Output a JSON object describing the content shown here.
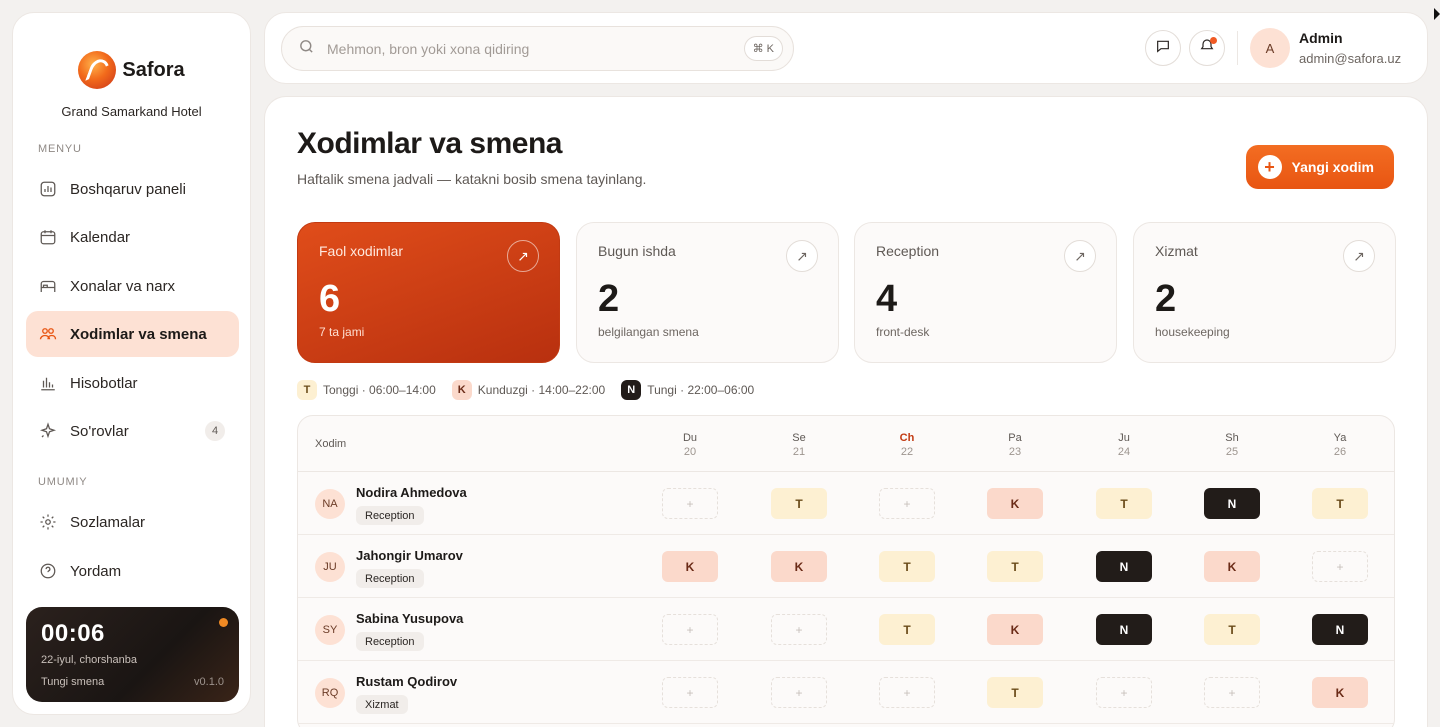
{
  "brand": {
    "name": "Safora",
    "hotel": "Grand Samarkand Hotel"
  },
  "sidebar": {
    "menu_label": "MENYU",
    "menu": [
      {
        "label": "Boshqaruv paneli",
        "icon": "dashboard-icon"
      },
      {
        "label": "Kalendar",
        "icon": "calendar-icon"
      },
      {
        "label": "Xonalar va narx",
        "icon": "bed-icon"
      },
      {
        "label": "Xodimlar va smena",
        "icon": "users-icon",
        "active": true
      },
      {
        "label": "Hisobotlar",
        "icon": "bar-chart-icon"
      },
      {
        "label": "So'rovlar",
        "icon": "sparkle-icon",
        "badge": "4"
      }
    ],
    "general_label": "UMUMIY",
    "general": [
      {
        "label": "Sozlamalar",
        "icon": "gear-icon"
      },
      {
        "label": "Yordam",
        "icon": "help-icon"
      }
    ],
    "clock": {
      "time": "00:06",
      "date": "22-iyul, chorshanba",
      "shift": "Tungi smena",
      "version": "v0.1.0"
    }
  },
  "topbar": {
    "search_placeholder": "Mehmon, bron yoki xona qidiring",
    "shortcut": "⌘ K",
    "user": {
      "initial": "A",
      "name": "Admin",
      "email": "admin@safora.uz"
    }
  },
  "page": {
    "title": "Xodimlar va smena",
    "subtitle": "Haftalik smena jadvali — katakni bosib smena tayinlang.",
    "add_button": "Yangi xodim"
  },
  "stats": [
    {
      "label": "Faol xodimlar",
      "value": "6",
      "note": "7 ta jami"
    },
    {
      "label": "Bugun ishda",
      "value": "2",
      "note": "belgilangan smena"
    },
    {
      "label": "Reception",
      "value": "4",
      "note": "front-desk"
    },
    {
      "label": "Xizmat",
      "value": "2",
      "note": "housekeeping"
    }
  ],
  "legend": [
    {
      "code": "T",
      "text": "Tonggi · 06:00–14:00"
    },
    {
      "code": "K",
      "text": "Kunduzgi · 14:00–22:00"
    },
    {
      "code": "N",
      "text": "Tungi · 22:00–06:00"
    }
  ],
  "schedule": {
    "name_header": "Xodim",
    "days": [
      {
        "day": "Du",
        "date": "20"
      },
      {
        "day": "Se",
        "date": "21"
      },
      {
        "day": "Ch",
        "date": "22",
        "today": true
      },
      {
        "day": "Pa",
        "date": "23"
      },
      {
        "day": "Ju",
        "date": "24"
      },
      {
        "day": "Sh",
        "date": "25"
      },
      {
        "day": "Ya",
        "date": "26"
      }
    ],
    "rows": [
      {
        "initials": "NA",
        "name": "Nodira Ahmedova",
        "role": "Reception",
        "shifts": [
          "",
          "T",
          "",
          "K",
          "T",
          "N",
          "T"
        ]
      },
      {
        "initials": "JU",
        "name": "Jahongir Umarov",
        "role": "Reception",
        "shifts": [
          "K",
          "K",
          "T",
          "T",
          "N",
          "K",
          ""
        ]
      },
      {
        "initials": "SY",
        "name": "Sabina Yusupova",
        "role": "Reception",
        "shifts": [
          "",
          "",
          "T",
          "K",
          "N",
          "T",
          "N"
        ]
      },
      {
        "initials": "RQ",
        "name": "Rustam Qodirov",
        "role": "Xizmat",
        "shifts": [
          "",
          "",
          "",
          "T",
          "",
          "",
          "K"
        ]
      }
    ],
    "empty_symbol": "+"
  },
  "colors": {
    "accent": "#e85512",
    "active_nav": "#fde1d4",
    "morning": "#fdf0d2",
    "day": "#fbd9cb",
    "night": "#221c19"
  }
}
